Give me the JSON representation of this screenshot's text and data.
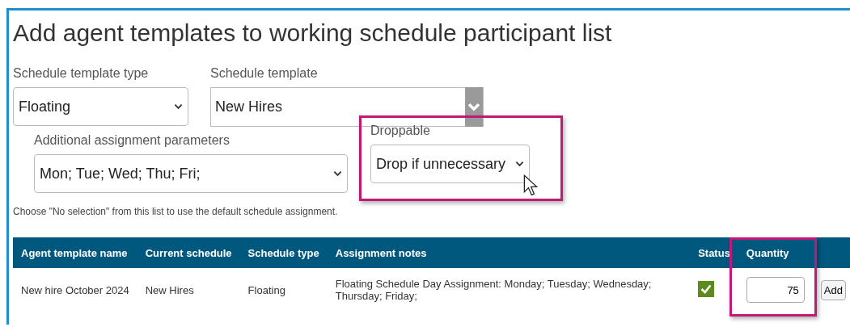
{
  "title": "Add agent templates to working schedule participant list",
  "rows_of_fields": [
    [
      {
        "label": "Schedule template type",
        "value": "Floating",
        "kind": "select",
        "highlighted": false
      },
      {
        "label": "Schedule template",
        "value": "New Hires",
        "kind": "combo",
        "highlighted": false
      }
    ],
    [
      {
        "label": "Additional assignment parameters",
        "value": "Mon; Tue; Wed; Thu; Fri;",
        "kind": "select",
        "highlighted": false
      },
      {
        "label": "Droppable",
        "value": "Drop if unnecessary",
        "kind": "select",
        "highlighted": true
      }
    ]
  ],
  "note": "Choose \"No selection\" from this list to use the default schedule assignment.",
  "table": {
    "columns": [
      {
        "label": "Agent template name",
        "highlighted": false
      },
      {
        "label": "Current schedule",
        "highlighted": false
      },
      {
        "label": "Schedule type",
        "highlighted": false
      },
      {
        "label": "Assignment notes",
        "highlighted": false
      },
      {
        "label": "Status",
        "highlighted": false
      },
      {
        "label": "Quantity",
        "highlighted": true
      }
    ],
    "rows": [
      {
        "agent_template_name": "New hire October 2024",
        "current_schedule": "New Hires",
        "schedule_type": "Floating",
        "assignment_notes": "Floating Schedule Day Assignment: Monday; Tuesday; Wednesday; Thursday; Friday;",
        "status_checked": true,
        "quantity": "75",
        "button": "Add"
      }
    ]
  }
}
